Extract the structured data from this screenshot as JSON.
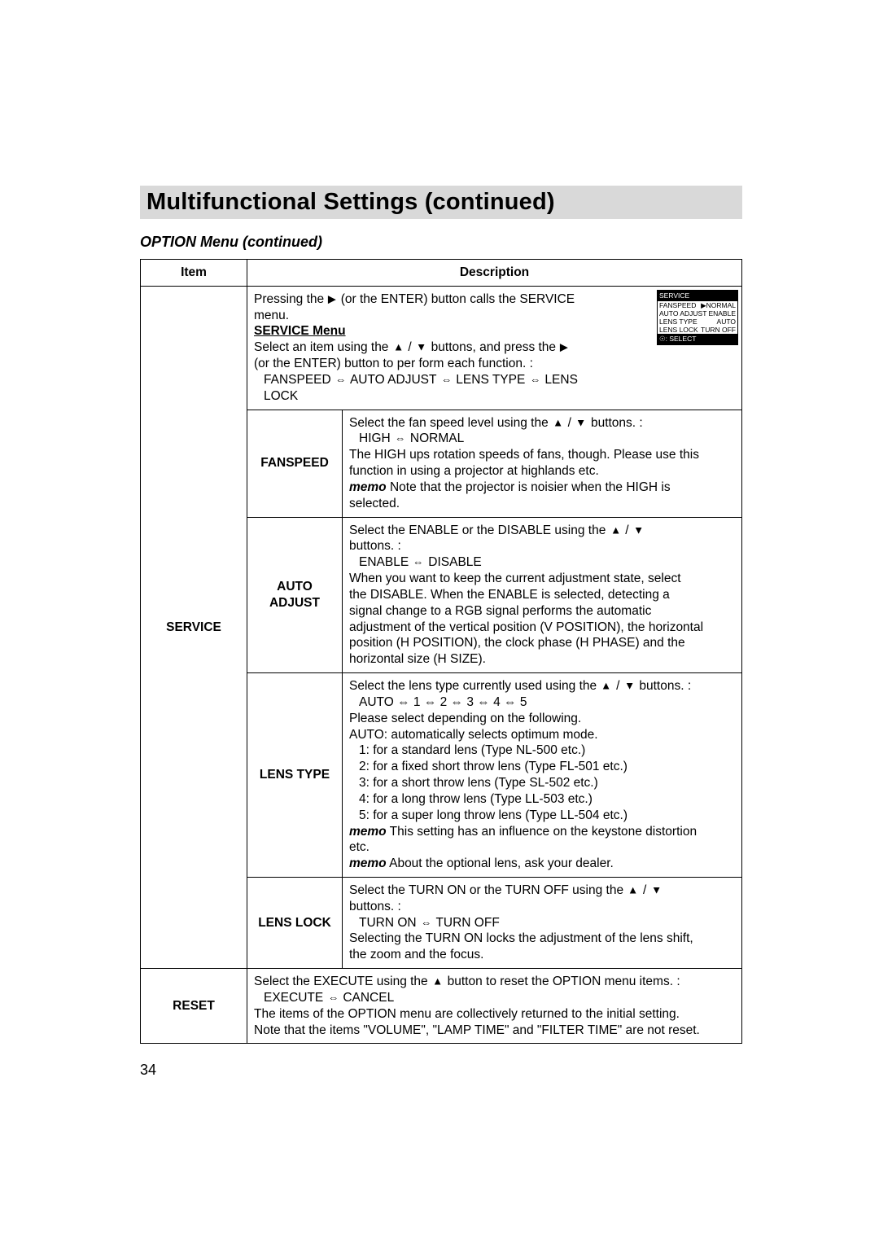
{
  "title": "Multifunctional Settings (continued)",
  "subtitle": "OPTION Menu (continued)",
  "table_headers": {
    "item": "Item",
    "desc": "Description"
  },
  "service_label": "SERVICE",
  "reset_label": "RESET",
  "intro": {
    "l1_pre": "Pressing the ",
    "l1_post": " (or the ENTER) button calls the SERVICE",
    "l2": "menu.",
    "menu_heading": "SERVICE Menu",
    "sel_pre": "Select an item using the ",
    "sel_mid": " / ",
    "sel_post": " buttons, and press the ",
    "sel_line2": "(or the ENTER) button to per form each function. :",
    "cycle_pre": "FANSPEED ",
    "cycle_a": " AUTO ADJUST ",
    "cycle_b": " LENS TYPE ",
    "cycle_c": " LENS LOCK"
  },
  "service_menu": {
    "header": "SERVICE",
    "rows": [
      {
        "left": "FANSPEED",
        "right_pre": "",
        "right": "NORMAL",
        "cursor": true
      },
      {
        "left": "AUTO ADJUST",
        "right": "ENABLE"
      },
      {
        "left": "LENS TYPE",
        "right": "AUTO"
      },
      {
        "left": "LENS LOCK",
        "right": "TURN OFF"
      }
    ],
    "footer_label": ": SELECT"
  },
  "fanspeed": {
    "label": "FANSPEED",
    "l1_pre": "Select the fan speed level using the ",
    "l1_mid": " / ",
    "l1_post": " buttons. :",
    "l2_pre": "HIGH ",
    "l2_post": " NORMAL",
    "l3": "The HIGH ups rotation speeds of fans, though. Please use this",
    "l4": "function in using a projector at highlands etc.",
    "memo_label": "memo",
    "memo_text": " Note that the projector is noisier when the HIGH is",
    "memo_text2": "selected."
  },
  "autoadjust": {
    "label_l1": "AUTO",
    "label_l2": "ADJUST",
    "l1_pre": "Select the ENABLE or the DISABLE using the ",
    "l1_mid": " / ",
    "l2": "buttons. :",
    "l3_pre": "ENABLE ",
    "l3_post": " DISABLE",
    "p1": "When you want to keep the current adjustment state, select",
    "p2": "the DISABLE. When the ENABLE is selected, detecting a",
    "p3": "signal change to a RGB signal performs the automatic",
    "p4": "adjustment of the vertical position (V POSITION), the horizontal",
    "p5": "position (H POSITION), the clock phase (H PHASE) and the",
    "p6": "horizontal size (H SIZE)."
  },
  "lenstype": {
    "label": "LENS TYPE",
    "l1_pre": "Select the lens type currently used using the ",
    "l1_mid": " / ",
    "l1_post": " buttons. :",
    "l2": "AUTO ⇔ 1 ⇔ 2 ⇔ 3 ⇔ 4 ⇔ 5",
    "l3": "Please select depending on the following.",
    "l4": "AUTO: automatically selects optimum mode.",
    "l5": "1: for a standard lens (Type NL-500 etc.)",
    "l6": "2: for a fixed short throw lens (Type FL-501 etc.)",
    "l7": "3: for a short throw lens (Type SL-502 etc.)",
    "l8": "4: for a long throw lens (Type LL-503 etc.)",
    "l9": "5: for a super long throw lens (Type LL-504 etc.)",
    "memo_label": "memo",
    "memo1": " This setting has an influence on the keystone distortion",
    "memo1b": "etc.",
    "memo2": " About the optional lens, ask your dealer."
  },
  "lenslock": {
    "label": "LENS LOCK",
    "l1_pre": "Select the TURN ON or the TURN OFF using the ",
    "l1_mid": " / ",
    "l2": "buttons. :",
    "l3_pre": "TURN ON ",
    "l3_post": " TURN OFF",
    "p1": "Selecting the TURN ON locks the adjustment of the lens shift,",
    "p2": "the zoom and the focus."
  },
  "reset": {
    "l1_pre": "Select the EXECUTE using the ",
    "l1_post": " button to reset the OPTION menu items. :",
    "l2_pre": "EXECUTE ",
    "l2_post": " CANCEL",
    "l3": "The items of the OPTION menu are collectively returned to the initial setting.",
    "l4": "Note that the items \"VOLUME\", \"LAMP TIME\" and \"FILTER TIME\" are not reset."
  },
  "page_number": "34"
}
